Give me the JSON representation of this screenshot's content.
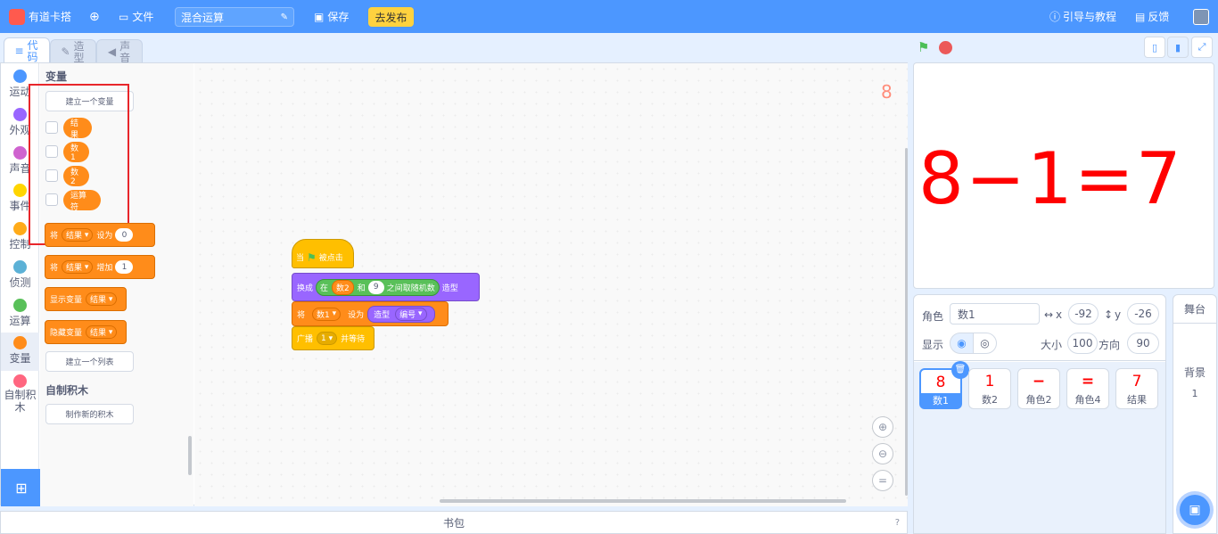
{
  "topbar": {
    "brand": "有道卡搭",
    "file_menu": "文件",
    "project_title": "混合运算",
    "save": "保存",
    "publish": "去发布",
    "guide": "引导与教程",
    "feedback": "反馈"
  },
  "tabs": [
    {
      "label": "代码"
    },
    {
      "label": "造型"
    },
    {
      "label": "声音"
    }
  ],
  "categories": [
    {
      "label": "运动",
      "color": "#4c97ff"
    },
    {
      "label": "外观",
      "color": "#9966ff"
    },
    {
      "label": "声音",
      "color": "#cf63cf"
    },
    {
      "label": "事件",
      "color": "#ffd500"
    },
    {
      "label": "控制",
      "color": "#ffab19"
    },
    {
      "label": "侦测",
      "color": "#5cb1d6"
    },
    {
      "label": "运算",
      "color": "#59c059"
    },
    {
      "label": "变量",
      "color": "#ff8c1a"
    },
    {
      "label": "自制积木",
      "color": "#ff6680"
    }
  ],
  "palette": {
    "variables_title": "变量",
    "make_variable": "建立一个变量",
    "variables": [
      "结果",
      "数1",
      "数2",
      "运算符"
    ],
    "set_block": {
      "prefix": "将",
      "var": "结果",
      "mid": "设为",
      "value": "0"
    },
    "change_block": {
      "prefix": "将",
      "var": "结果",
      "mid": "增加",
      "value": "1"
    },
    "show_block": {
      "prefix": "显示变量",
      "var": "结果"
    },
    "hide_block": {
      "prefix": "隐藏变量",
      "var": "结果"
    },
    "make_list": "建立一个列表",
    "my_blocks_title": "自制积木",
    "make_block": "制作新的积木"
  },
  "script": {
    "hat": {
      "prefix": "当",
      "suffix": "被点击"
    },
    "switch_costume": {
      "prefix": "换成",
      "in": "在",
      "var": "数2",
      "and": "和",
      "value": "9",
      "between": "之间取随机数",
      "suffix": "造型"
    },
    "set_var": {
      "prefix": "将",
      "var": "数1",
      "mid": "设为",
      "costume": "造型",
      "field": "编号"
    },
    "broadcast": {
      "prefix": "广播",
      "msg": "1",
      "suffix": "并等待"
    }
  },
  "canvas_readout": "8",
  "stage_display": {
    "expression": "8−1=7"
  },
  "sprite_info": {
    "sprite_label": "角色",
    "sprite_name": "数1",
    "x_label": "x",
    "x": "-92",
    "y_label": "y",
    "y": "-26",
    "show_label": "显示",
    "size_label": "大小",
    "size": "100",
    "direction_label": "方向",
    "direction": "90"
  },
  "sprites": [
    {
      "glyph": "8",
      "name": "数1",
      "selected": true
    },
    {
      "glyph": "1",
      "name": "数2",
      "selected": false
    },
    {
      "glyph": "−",
      "name": "角色2",
      "selected": false
    },
    {
      "glyph": "=",
      "name": "角色4",
      "selected": false
    },
    {
      "glyph": "7",
      "name": "结果",
      "selected": false
    }
  ],
  "stage_panel": {
    "title": "舞台",
    "backdrop_label": "背景",
    "backdrop_count": "1"
  },
  "backpack": "书包"
}
